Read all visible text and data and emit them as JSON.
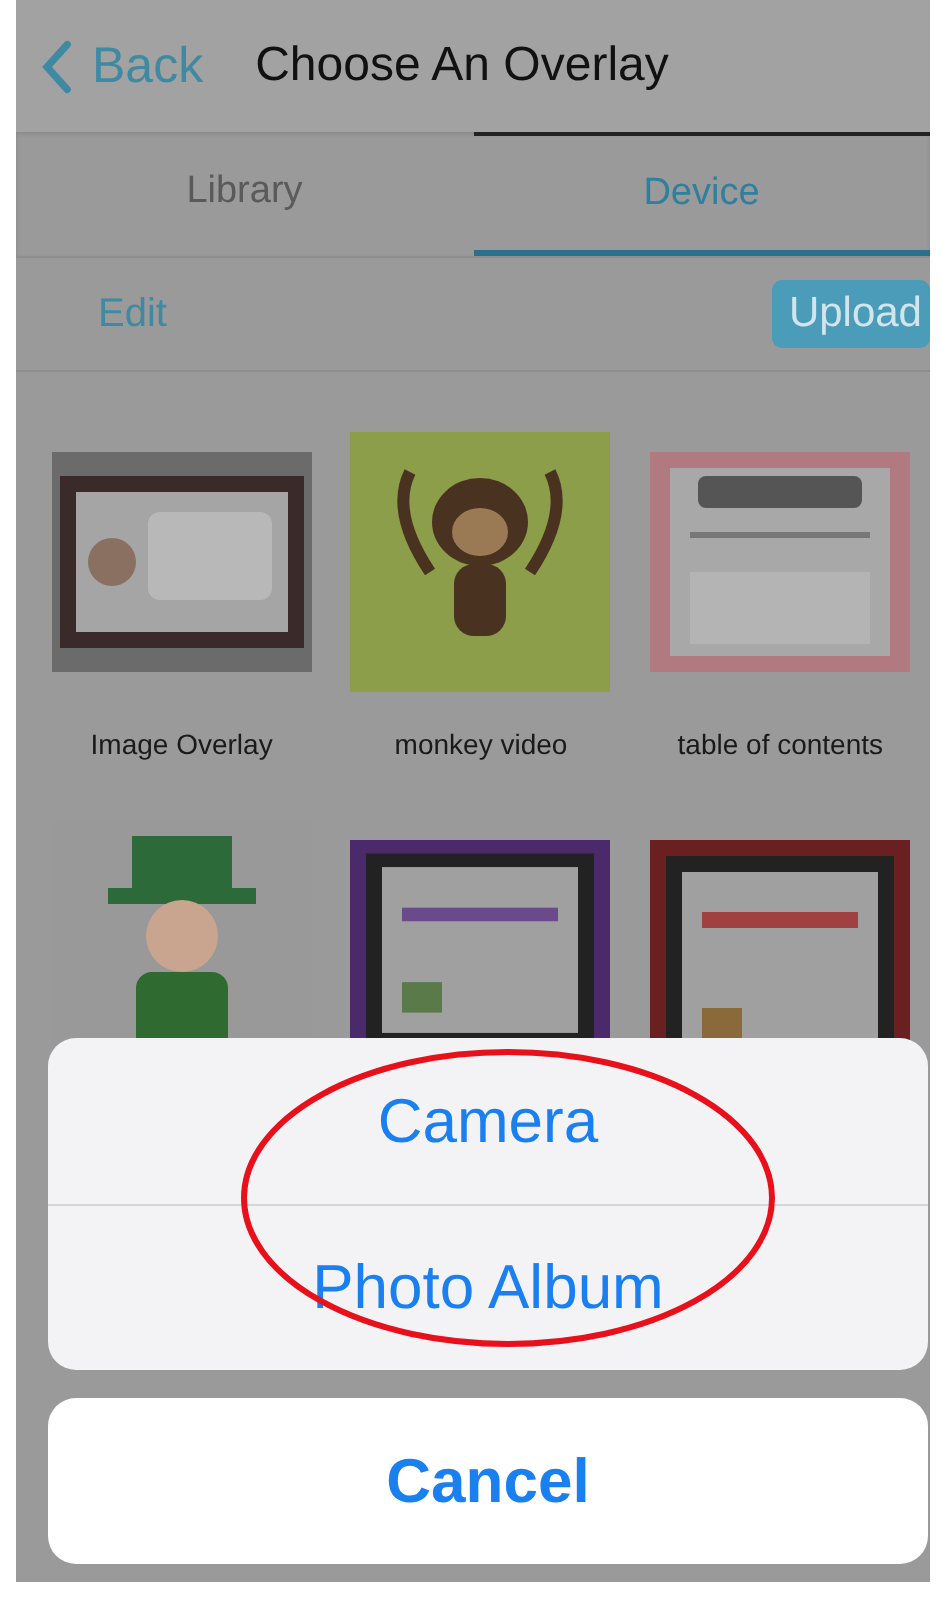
{
  "nav_bar": {
    "back_label": "Back",
    "title": "Choose An Overlay"
  },
  "tabs": [
    {
      "label": "Library",
      "selected": false
    },
    {
      "label": "Device",
      "selected": true
    }
  ],
  "toolbar": {
    "edit_label": "Edit",
    "upload_label": "Upload"
  },
  "thumbnails": [
    {
      "kind": "picture",
      "label": "Image Overlay"
    },
    {
      "kind": "picture",
      "label": "monkey video"
    },
    {
      "kind": "picture",
      "label": "table of contents"
    },
    {
      "kind": "picture"
    },
    {
      "kind": "picture"
    },
    {
      "kind": "picture"
    }
  ],
  "action_sheet": {
    "options": [
      "Camera",
      "Photo Album"
    ],
    "cancel": "Cancel"
  }
}
